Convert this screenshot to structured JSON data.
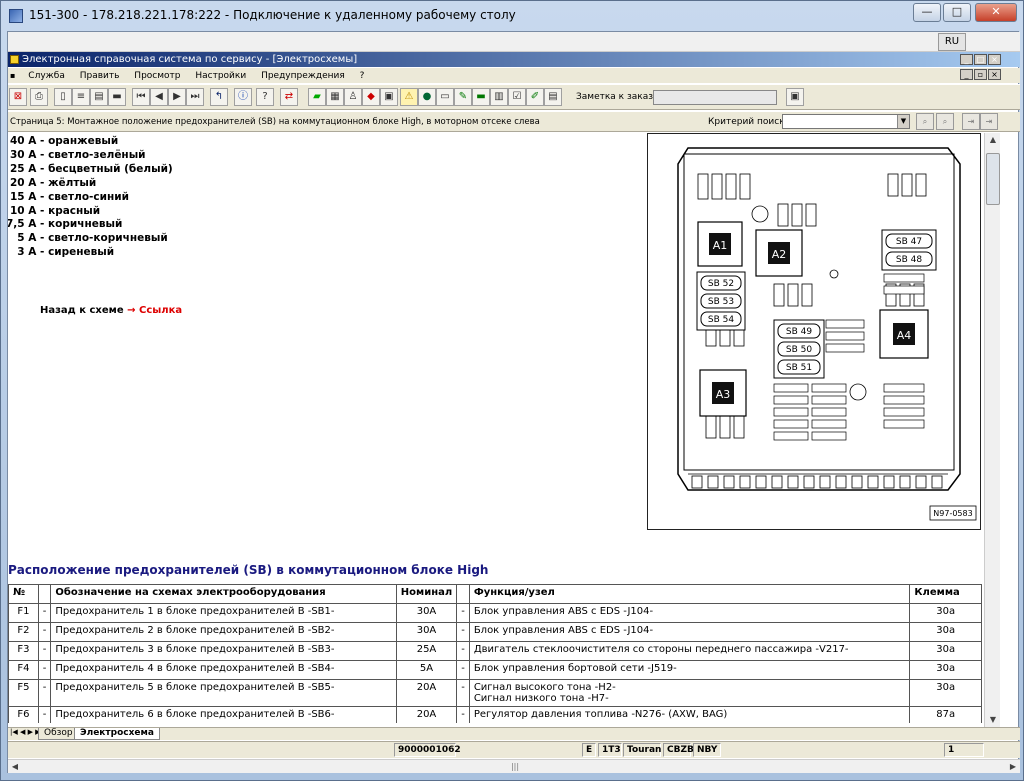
{
  "rdp": {
    "title": "151-300 - 178.218.221.178:222 - Подключение к удаленному рабочему столу",
    "min": "—",
    "max": "□",
    "close": "✕"
  },
  "lang": "RU",
  "app": {
    "title": "Электронная справочная система по сервису - [Электросхемы]",
    "win_min": "_",
    "win_max": "□",
    "win_close": "×"
  },
  "menu": [
    "Служба",
    "Править",
    "Просмотр",
    "Настройки",
    "Предупреждения",
    "?"
  ],
  "toolbar": {
    "order_label": "Заметка к заказу:"
  },
  "pathbar": {
    "text": "Страница 5: Монтажное положение предохранителей (SB) на коммутационном блоке High, в моторном отсеке слева",
    "criteria_label": "Критерий поиска:"
  },
  "legend": [
    "40 А - оранжевый",
    "30 А - светло-зелёный",
    "25 А - бесцветный (белый)",
    "20 А - жёлтый",
    "15 А - светло-синий",
    "10 А - красный",
    "7,5 А - коричневый",
    "  5 А - светло-коричневый",
    "  3 А - сиреневый"
  ],
  "back": {
    "text": "Назад к схеме",
    "arrow": "→",
    "link": "Ссылка"
  },
  "diagram": {
    "ref": "N97-0583",
    "relays": [
      "A1",
      "A2",
      "A3",
      "A4"
    ],
    "fuses_left": [
      "SB 52",
      "SB 53",
      "SB 54"
    ],
    "fuses_mid": [
      "SB 49",
      "SB 50",
      "SB 51"
    ],
    "fuses_right": [
      "SB 47",
      "SB 48"
    ]
  },
  "heading": "Расположение предохранителей (SB) в коммутационном блоке High",
  "table": {
    "headers": [
      "№",
      "Обозначение на схемах электрооборудования",
      "Номинал",
      "Функция/узел",
      "Клемма"
    ],
    "rows": [
      {
        "n": "F1",
        "d": "Предохранитель 1 в блоке предохранителей B -SB1-",
        "v": "30A",
        "f": "Блок управления ABS с EDS -J104-",
        "k": "30a"
      },
      {
        "n": "F2",
        "d": "Предохранитель 2 в блоке предохранителей B -SB2-",
        "v": "30A",
        "f": "Блок управления ABS с EDS -J104-",
        "k": "30a"
      },
      {
        "n": "F3",
        "d": "Предохранитель 3 в блоке предохранителей B -SB3-",
        "v": "25A",
        "f": "Двигатель стеклоочистителя со стороны переднего пассажира -V217-",
        "k": "30a"
      },
      {
        "n": "F4",
        "d": "Предохранитель 4 в блоке предохранителей B -SB4-",
        "v": "5A",
        "f": "Блок управления бортовой сети -J519-",
        "k": "30a"
      },
      {
        "n": "F5",
        "d": "Предохранитель 5 в блоке предохранителей B -SB5-",
        "v": "20A",
        "f": "Сигнал высокого тона -H2-",
        "f2": "Сигнал низкого тона -H7-",
        "k": "30a"
      },
      {
        "n": "F6",
        "d": "Предохранитель 6 в блоке предохранителей B -SB6-",
        "v": "20A",
        "f": "Регулятор давления топлива -N276- (AXW, BAG)",
        "k": "87a"
      }
    ]
  },
  "tabs": [
    "Обзор",
    "Электросхема"
  ],
  "status": {
    "code": "9000001062",
    "e": "E",
    "model_code": "1T3",
    "model": "Touran",
    "engine": "CBZB",
    "gear": "NBY",
    "page": "1"
  }
}
